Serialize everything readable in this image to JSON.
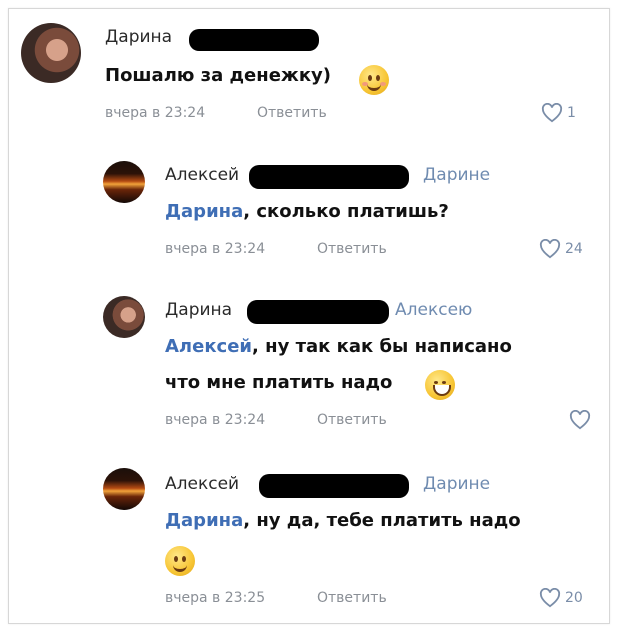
{
  "comments": [
    {
      "author": "Дарина",
      "reply_to": "",
      "mention": "",
      "text": "Пошалю за денежку)",
      "emoji": "blushing-smile",
      "time": "вчера в 23:24",
      "reply_label": "Ответить",
      "likes": "1"
    },
    {
      "author": "Алексей",
      "reply_to": "Дарине",
      "mention": "Дарина",
      "text": ", сколько платишь?",
      "emoji": "",
      "time": "вчера в 23:24",
      "reply_label": "Ответить",
      "likes": "24"
    },
    {
      "author": "Дарина",
      "reply_to": "Алексею",
      "mention": "Алексей",
      "text": ", ну так как бы написано",
      "text2": "что мне платить надо",
      "emoji": "grin",
      "time": "вчера в 23:24",
      "reply_label": "Ответить",
      "likes": ""
    },
    {
      "author": "Алексей",
      "reply_to": "Дарине",
      "mention": "Дарина",
      "text": ", ну да, тебе платить надо",
      "emoji": "smile",
      "time": "вчера в 23:25",
      "reply_label": "Ответить",
      "likes": "20"
    }
  ]
}
